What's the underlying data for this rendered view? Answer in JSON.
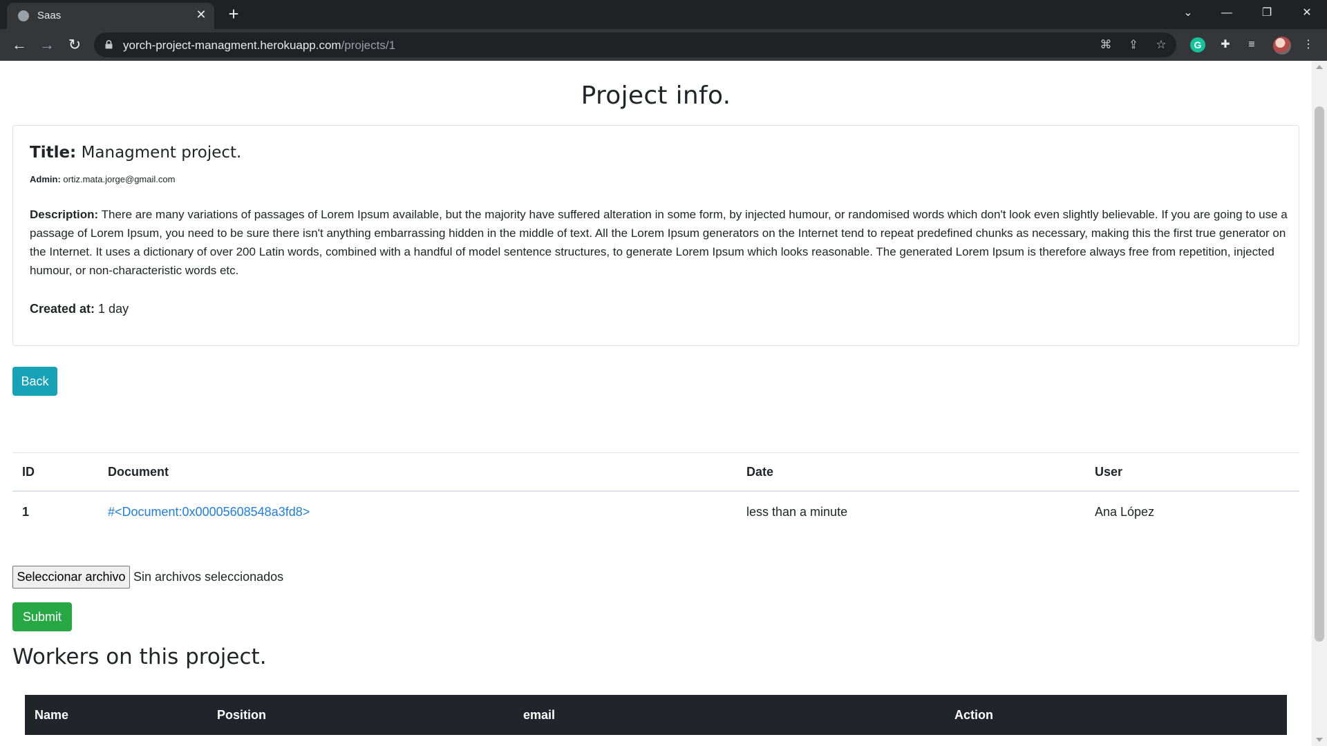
{
  "browser": {
    "tab_title": "Saas",
    "url_host": "yorch-project-managment.herokuapp.com",
    "url_path": "/projects/1"
  },
  "page": {
    "heading": "Project info.",
    "project": {
      "title_label": "Title:",
      "title_value": "Managment project.",
      "admin_label": "Admin:",
      "admin_value": "ortiz.mata.jorge@gmail.com",
      "description_label": "Description:",
      "description_value": "There are many variations of passages of Lorem Ipsum available, but the majority have suffered alteration in some form, by injected humour, or randomised words which don't look even slightly believable. If you are going to use a passage of Lorem Ipsum, you need to be sure there isn't anything embarrassing hidden in the middle of text. All the Lorem Ipsum generators on the Internet tend to repeat predefined chunks as necessary, making this the first true generator on the Internet. It uses a dictionary of over 200 Latin words, combined with a handful of model sentence structures, to generate Lorem Ipsum which looks reasonable. The generated Lorem Ipsum is therefore always free from repetition, injected humour, or non-characteristic words etc.",
      "created_label": "Created at:",
      "created_value": "1 day"
    },
    "back_label": "Back",
    "documents": {
      "columns": [
        "ID",
        "Document",
        "Date",
        "User"
      ],
      "rows": [
        {
          "id": "1",
          "document": "#<Document:0x00005608548a3fd8>",
          "date": "less than a minute",
          "user": "Ana López"
        }
      ]
    },
    "file_input": {
      "button_label": "Seleccionar archivo",
      "status": "Sin archivos seleccionados"
    },
    "submit_label": "Submit",
    "workers": {
      "heading": "Workers on this project.",
      "columns": [
        "Name",
        "Position",
        "email",
        "Action"
      ]
    }
  },
  "colors": {
    "back_button": "#17a2b8",
    "submit_button": "#28a745",
    "link": "#1e7fe0",
    "table_header_dark": "#212529"
  }
}
